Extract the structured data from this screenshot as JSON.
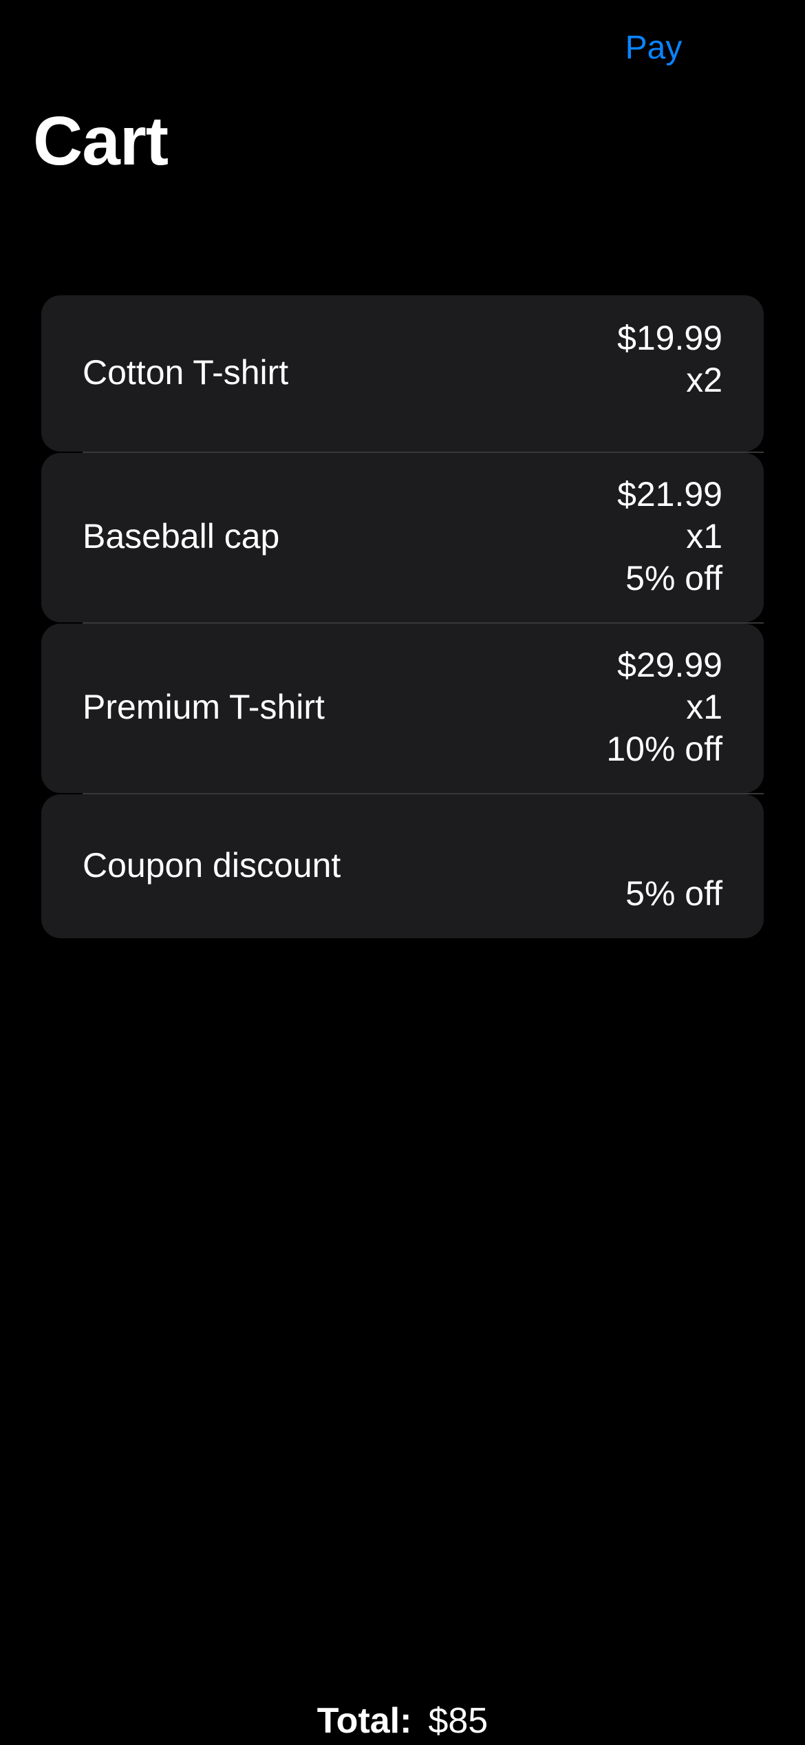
{
  "nav": {
    "pay_label": "Pay"
  },
  "page": {
    "title": "Cart"
  },
  "cart": {
    "items": [
      {
        "name": "Cotton T-shirt",
        "price": "$19.99",
        "quantity": "x2",
        "discount": ""
      },
      {
        "name": "Baseball cap",
        "price": "$21.99",
        "quantity": "x1",
        "discount": "5% off"
      },
      {
        "name": "Premium T-shirt",
        "price": "$29.99",
        "quantity": "x1",
        "discount": "10% off"
      }
    ],
    "coupon": {
      "name": "Coupon discount",
      "discount": "5% off"
    }
  },
  "total": {
    "label": "Total:",
    "value": "$85"
  },
  "colors": {
    "background": "#000000",
    "card": "#1c1c1e",
    "accent": "#0a84ff",
    "separator": "#38383a",
    "text": "#ffffff"
  }
}
